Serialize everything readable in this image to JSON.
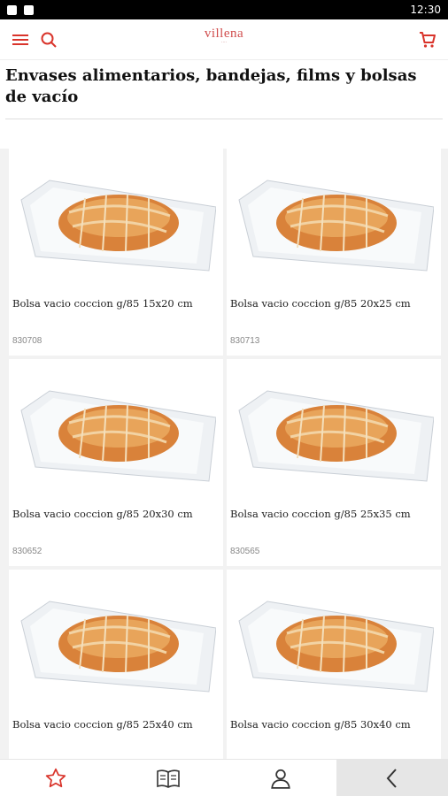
{
  "status_bar": {
    "time": "12:30",
    "icons": [
      "image-icon",
      "sd-card-icon"
    ]
  },
  "app_bar": {
    "logo_text": "villena",
    "logo_subtext": "····",
    "menu_icon": "hamburger-icon",
    "search_icon": "search-icon",
    "cart_icon": "cart-icon",
    "accent_color": "#d9342b"
  },
  "page": {
    "title": "Envases alimentarios, bandejas, films y bolsas de vacío"
  },
  "products": [
    {
      "name": "Bolsa vacio coccion g/85 15x20 cm",
      "code": "830708"
    },
    {
      "name": "Bolsa vacio coccion g/85 20x25 cm",
      "code": "830713"
    },
    {
      "name": "Bolsa vacio coccion g/85 20x30 cm",
      "code": "830652"
    },
    {
      "name": "Bolsa vacio coccion g/85 25x35 cm",
      "code": "830565"
    },
    {
      "name": "Bolsa vacio coccion g/85 25x40 cm",
      "code": ""
    },
    {
      "name": "Bolsa vacio coccion g/85 30x40 cm",
      "code": ""
    }
  ],
  "bottom_nav": {
    "items": [
      "star-icon",
      "catalog-book-icon",
      "user-icon",
      "back-chevron-icon"
    ]
  }
}
